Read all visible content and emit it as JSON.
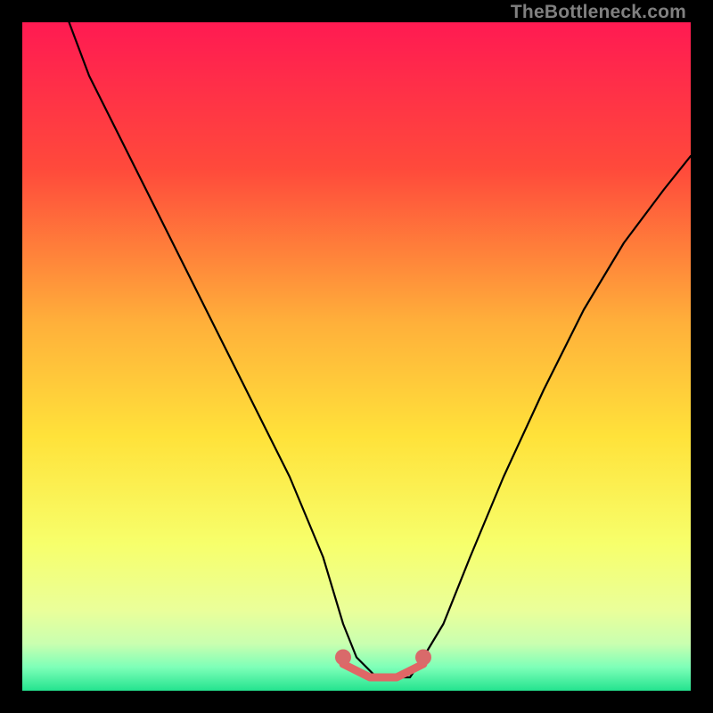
{
  "watermark": "TheBottleneck.com",
  "chart_data": {
    "type": "line",
    "title": "",
    "xlabel": "",
    "ylabel": "",
    "xlim": [
      0,
      100
    ],
    "ylim": [
      0,
      100
    ],
    "gradient_stops": [
      {
        "offset": 0,
        "color": "#ff1a52"
      },
      {
        "offset": 0.22,
        "color": "#ff4a3b"
      },
      {
        "offset": 0.45,
        "color": "#ffb03a"
      },
      {
        "offset": 0.62,
        "color": "#ffe23a"
      },
      {
        "offset": 0.78,
        "color": "#f7ff6b"
      },
      {
        "offset": 0.88,
        "color": "#eaff9a"
      },
      {
        "offset": 0.93,
        "color": "#c9ffb0"
      },
      {
        "offset": 0.965,
        "color": "#7dffb8"
      },
      {
        "offset": 1.0,
        "color": "#24e38f"
      }
    ],
    "series": [
      {
        "name": "bottleneck-curve",
        "color": "#000000",
        "x": [
          7,
          10,
          15,
          20,
          25,
          30,
          35,
          40,
          45,
          48,
          50,
          53,
          56,
          58,
          60,
          63,
          67,
          72,
          78,
          84,
          90,
          96,
          100
        ],
        "values": [
          100,
          92,
          82,
          72,
          62,
          52,
          42,
          32,
          20,
          10,
          5,
          2,
          2,
          2,
          5,
          10,
          20,
          32,
          45,
          57,
          67,
          75,
          80
        ]
      },
      {
        "name": "optimal-zone-highlight",
        "color": "#e06666",
        "x": [
          48,
          50,
          52,
          54,
          56,
          58,
          60
        ],
        "values": [
          4,
          3,
          2,
          2,
          2,
          3,
          4
        ]
      }
    ],
    "markers": [
      {
        "name": "optimal-left-dot",
        "x": 48,
        "y": 5,
        "color": "#d96a6a",
        "r": 1.2
      },
      {
        "name": "optimal-right-dot",
        "x": 60,
        "y": 5,
        "color": "#d96a6a",
        "r": 1.2
      }
    ]
  }
}
